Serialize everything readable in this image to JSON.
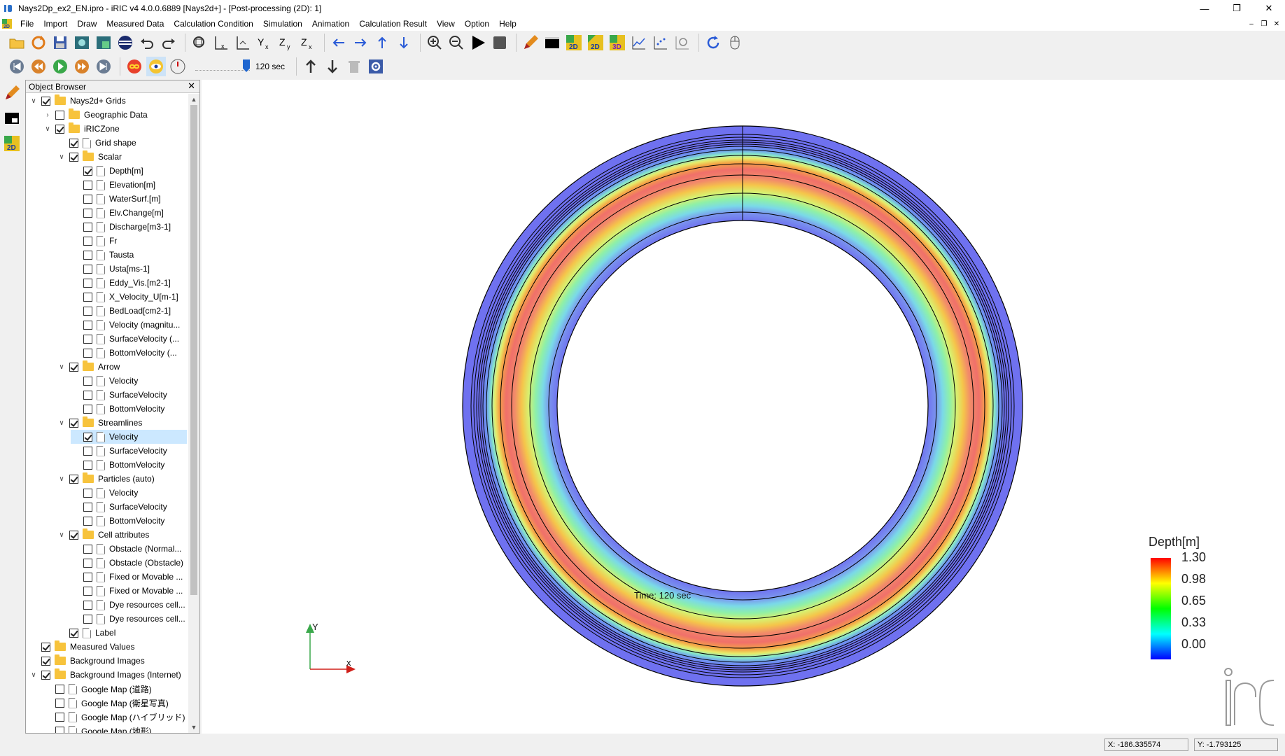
{
  "window": {
    "title": "Nays2Dp_ex2_EN.ipro - iRIC v4 4.0.0.6889 [Nays2d+] - [Post-processing (2D): 1]",
    "controls": [
      "—",
      "❐",
      "✕"
    ]
  },
  "menu": {
    "items": [
      "File",
      "Import",
      "Draw",
      "Measured Data",
      "Calculation Condition",
      "Simulation",
      "Animation",
      "Calculation Result",
      "View",
      "Option",
      "Help"
    ],
    "mdi_controls": [
      "–",
      "❐",
      "✕"
    ]
  },
  "toolbar": {
    "time_value": "120 sec"
  },
  "object_browser": {
    "title": "Object Browser",
    "close": "✕",
    "tree": [
      {
        "label": "Nays2d+ Grids",
        "level": 0,
        "expander": "open",
        "checked": true,
        "icon": "folder"
      },
      {
        "label": "Geographic Data",
        "level": 1,
        "expander": "closed",
        "checked": false,
        "icon": "folder"
      },
      {
        "label": "iRICZone",
        "level": 1,
        "expander": "open",
        "checked": true,
        "icon": "folder"
      },
      {
        "label": "Grid shape",
        "level": 2,
        "expander": "",
        "checked": true,
        "icon": "file"
      },
      {
        "label": "Scalar",
        "level": 2,
        "expander": "open",
        "checked": true,
        "icon": "folder"
      },
      {
        "label": "Depth[m]",
        "level": 3,
        "expander": "",
        "checked": true,
        "icon": "file"
      },
      {
        "label": "Elevation[m]",
        "level": 3,
        "expander": "",
        "checked": false,
        "icon": "file"
      },
      {
        "label": "WaterSurf.[m]",
        "level": 3,
        "expander": "",
        "checked": false,
        "icon": "file"
      },
      {
        "label": "Elv.Change[m]",
        "level": 3,
        "expander": "",
        "checked": false,
        "icon": "file"
      },
      {
        "label": "Discharge[m3-1]",
        "level": 3,
        "expander": "",
        "checked": false,
        "icon": "file"
      },
      {
        "label": "Fr",
        "level": 3,
        "expander": "",
        "checked": false,
        "icon": "file"
      },
      {
        "label": "Tausta",
        "level": 3,
        "expander": "",
        "checked": false,
        "icon": "file"
      },
      {
        "label": "Usta[ms-1]",
        "level": 3,
        "expander": "",
        "checked": false,
        "icon": "file"
      },
      {
        "label": "Eddy_Vis.[m2-1]",
        "level": 3,
        "expander": "",
        "checked": false,
        "icon": "file"
      },
      {
        "label": "X_Velocity_U[m-1]",
        "level": 3,
        "expander": "",
        "checked": false,
        "icon": "file"
      },
      {
        "label": "BedLoad[cm2-1]",
        "level": 3,
        "expander": "",
        "checked": false,
        "icon": "file"
      },
      {
        "label": "Velocity (magnitu...",
        "level": 3,
        "expander": "",
        "checked": false,
        "icon": "file"
      },
      {
        "label": "SurfaceVelocity (...",
        "level": 3,
        "expander": "",
        "checked": false,
        "icon": "file"
      },
      {
        "label": "BottomVelocity (...",
        "level": 3,
        "expander": "",
        "checked": false,
        "icon": "file"
      },
      {
        "label": "Arrow",
        "level": 2,
        "expander": "open",
        "checked": true,
        "icon": "folder"
      },
      {
        "label": "Velocity",
        "level": 3,
        "expander": "",
        "checked": false,
        "icon": "file"
      },
      {
        "label": "SurfaceVelocity",
        "level": 3,
        "expander": "",
        "checked": false,
        "icon": "file"
      },
      {
        "label": "BottomVelocity",
        "level": 3,
        "expander": "",
        "checked": false,
        "icon": "file"
      },
      {
        "label": "Streamlines",
        "level": 2,
        "expander": "open",
        "checked": true,
        "icon": "folder"
      },
      {
        "label": "Velocity",
        "level": 3,
        "expander": "",
        "checked": true,
        "icon": "file",
        "selected": true
      },
      {
        "label": "SurfaceVelocity",
        "level": 3,
        "expander": "",
        "checked": false,
        "icon": "file"
      },
      {
        "label": "BottomVelocity",
        "level": 3,
        "expander": "",
        "checked": false,
        "icon": "file"
      },
      {
        "label": "Particles (auto)",
        "level": 2,
        "expander": "open",
        "checked": true,
        "icon": "folder"
      },
      {
        "label": "Velocity",
        "level": 3,
        "expander": "",
        "checked": false,
        "icon": "file"
      },
      {
        "label": "SurfaceVelocity",
        "level": 3,
        "expander": "",
        "checked": false,
        "icon": "file"
      },
      {
        "label": "BottomVelocity",
        "level": 3,
        "expander": "",
        "checked": false,
        "icon": "file"
      },
      {
        "label": "Cell attributes",
        "level": 2,
        "expander": "open",
        "checked": true,
        "icon": "folder"
      },
      {
        "label": "Obstacle (Normal...",
        "level": 3,
        "expander": "",
        "checked": false,
        "icon": "file"
      },
      {
        "label": "Obstacle (Obstacle)",
        "level": 3,
        "expander": "",
        "checked": false,
        "icon": "file"
      },
      {
        "label": "Fixed or Movable ...",
        "level": 3,
        "expander": "",
        "checked": false,
        "icon": "file"
      },
      {
        "label": "Fixed or Movable ...",
        "level": 3,
        "expander": "",
        "checked": false,
        "icon": "file"
      },
      {
        "label": "Dye resources cell...",
        "level": 3,
        "expander": "",
        "checked": false,
        "icon": "file"
      },
      {
        "label": "Dye resources cell...",
        "level": 3,
        "expander": "",
        "checked": false,
        "icon": "file"
      },
      {
        "label": "Label",
        "level": 2,
        "expander": "",
        "checked": true,
        "icon": "file"
      },
      {
        "label": "Measured Values",
        "level": 0,
        "expander": "",
        "checked": true,
        "icon": "folder"
      },
      {
        "label": "Background Images",
        "level": 0,
        "expander": "",
        "checked": true,
        "icon": "folder"
      },
      {
        "label": "Background Images (Internet)",
        "level": 0,
        "expander": "open",
        "checked": true,
        "icon": "folder"
      },
      {
        "label": "Google Map (道路)",
        "level": 1,
        "expander": "",
        "checked": false,
        "icon": "file"
      },
      {
        "label": "Google Map (衛星写真)",
        "level": 1,
        "expander": "",
        "checked": false,
        "icon": "file"
      },
      {
        "label": "Google Map (ハイブリッド)",
        "level": 1,
        "expander": "",
        "checked": false,
        "icon": "file"
      },
      {
        "label": "Google Map (地形)",
        "level": 1,
        "expander": "",
        "checked": false,
        "icon": "file"
      }
    ]
  },
  "viewport": {
    "axis_x": "x",
    "axis_y": "Y",
    "time_text": "Time:  120 sec",
    "legend": {
      "title": "Depth[m]",
      "ticks": [
        "1.30",
        "0.98",
        "0.65",
        "0.33",
        "0.00"
      ],
      "colors": [
        "#ff0000",
        "#ffff00",
        "#00ff00",
        "#00ffff",
        "#0000ff"
      ]
    },
    "logo_text": "iRIC"
  },
  "status": {
    "x": "X: -186.335574",
    "y": "Y: -1.793125"
  }
}
